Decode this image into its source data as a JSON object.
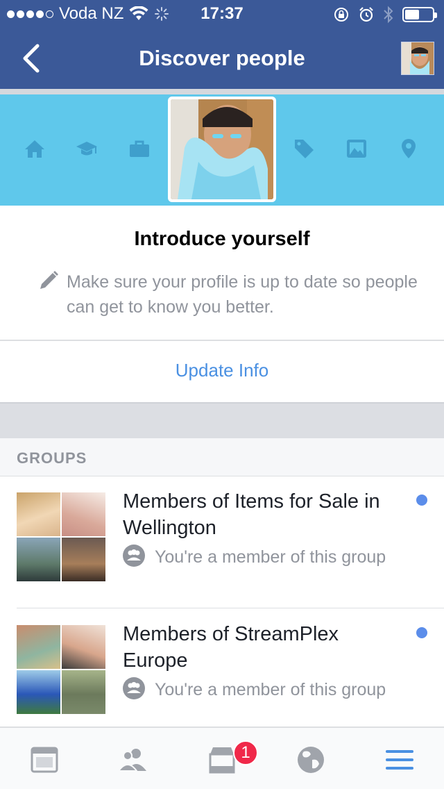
{
  "status_bar": {
    "carrier": "Voda NZ",
    "time": "17:37"
  },
  "nav": {
    "title": "Discover people"
  },
  "banner": {
    "icons": [
      "home-icon",
      "education-icon",
      "work-icon",
      "tag-icon",
      "photo-icon",
      "location-icon"
    ],
    "color": "#5fc8eb"
  },
  "intro": {
    "title": "Introduce yourself",
    "description": "Make sure your profile is up to date so people can get to know you better.",
    "action_label": "Update Info"
  },
  "groups": {
    "header": "GROUPS",
    "items": [
      {
        "name": "Members of Items for Sale in Wellington",
        "meta": "You're a member of this group"
      },
      {
        "name": "Members of StreamPlex Europe",
        "meta": "You're a member of this group"
      }
    ]
  },
  "tab_bar": {
    "tabs": [
      "news-feed-icon",
      "friends-icon",
      "marketplace-icon",
      "notifications-globe-icon",
      "menu-icon"
    ],
    "badge": "1"
  },
  "colors": {
    "brand": "#3b5998",
    "link": "#4a90e2",
    "badge": "#f02849"
  }
}
